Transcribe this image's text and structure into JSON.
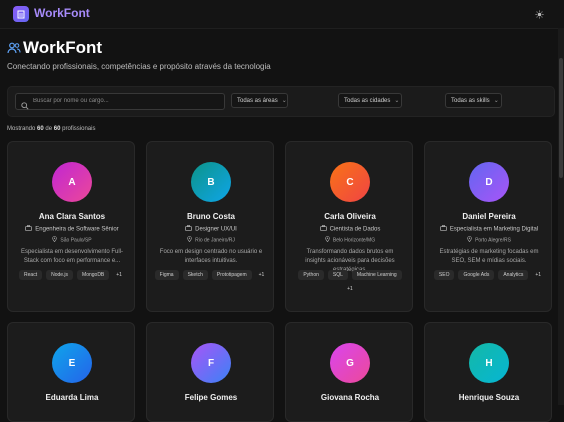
{
  "app": {
    "name": "WorkFont"
  },
  "hero": {
    "title": "WorkFont",
    "subtitle": "Conectando profissionais, competências e propósito através da tecnologia"
  },
  "filters": {
    "search_placeholder": "Buscar por nome ou cargo...",
    "areas": "Todas as áreas",
    "cities": "Todas as cidades",
    "skills": "Todas as skills"
  },
  "results": {
    "prefix": "Mostrando",
    "shown": "60",
    "middle": "de",
    "total": "60",
    "suffix": "profissionais"
  },
  "profiles": [
    {
      "initial": "A",
      "name": "Ana Clara Santos",
      "role": "Engenheira de Software Sênior",
      "location": "São Paulo/SP",
      "bio": "Especialista em desenvolvimento Full-Stack com foco em performance e...",
      "tags": [
        "React",
        "Node.js",
        "MongoDB",
        "+1"
      ],
      "gradient": [
        "#c026d3",
        "#ec4899"
      ]
    },
    {
      "initial": "B",
      "name": "Bruno Costa",
      "role": "Designer UX/UI",
      "location": "Rio de Janeiro/RJ",
      "bio": "Foco em design centrado no usuário e interfaces intuitivas.",
      "tags": [
        "Figma",
        "Sketch",
        "Prototipagem",
        "+1"
      ],
      "gradient": [
        "#0d9488",
        "#0ea5e9"
      ]
    },
    {
      "initial": "C",
      "name": "Carla Oliveira",
      "role": "Cientista de Dados",
      "location": "Belo Horizonte/MG",
      "bio": "Transformando dados brutos em insights acionáveis para decisões estratégicas.",
      "tags": [
        "Python",
        "SQL",
        "Machine Learning",
        "+1"
      ],
      "gradient": [
        "#f97316",
        "#ef4444"
      ]
    },
    {
      "initial": "D",
      "name": "Daniel Pereira",
      "role": "Especialista em Marketing Digital",
      "location": "Porto Alegre/RS",
      "bio": "Estratégias de marketing focadas em SEO, SEM e mídias sociais.",
      "tags": [
        "SEO",
        "Google Ads",
        "Analytics",
        "+1"
      ],
      "gradient": [
        "#6366f1",
        "#a855f7"
      ]
    },
    {
      "initial": "E",
      "name": "Eduarda Lima",
      "gradient": [
        "#0ea5e9",
        "#2563eb"
      ]
    },
    {
      "initial": "F",
      "name": "Felipe Gomes",
      "gradient": [
        "#a855f7",
        "#3b82f6"
      ]
    },
    {
      "initial": "G",
      "name": "Giovana Rocha",
      "gradient": [
        "#d946ef",
        "#ec4899"
      ]
    },
    {
      "initial": "H",
      "name": "Henrique Souza",
      "gradient": [
        "#14b8a6",
        "#06b6d4"
      ]
    }
  ],
  "colors": {
    "accent": "#a78bfa",
    "background": "#121212",
    "card": "#1c1c1c"
  },
  "icons": {
    "logo": "building-icon",
    "theme": "sun-icon",
    "hero": "users-icon",
    "search": "search-icon",
    "role": "briefcase-icon",
    "location": "map-pin-icon"
  }
}
